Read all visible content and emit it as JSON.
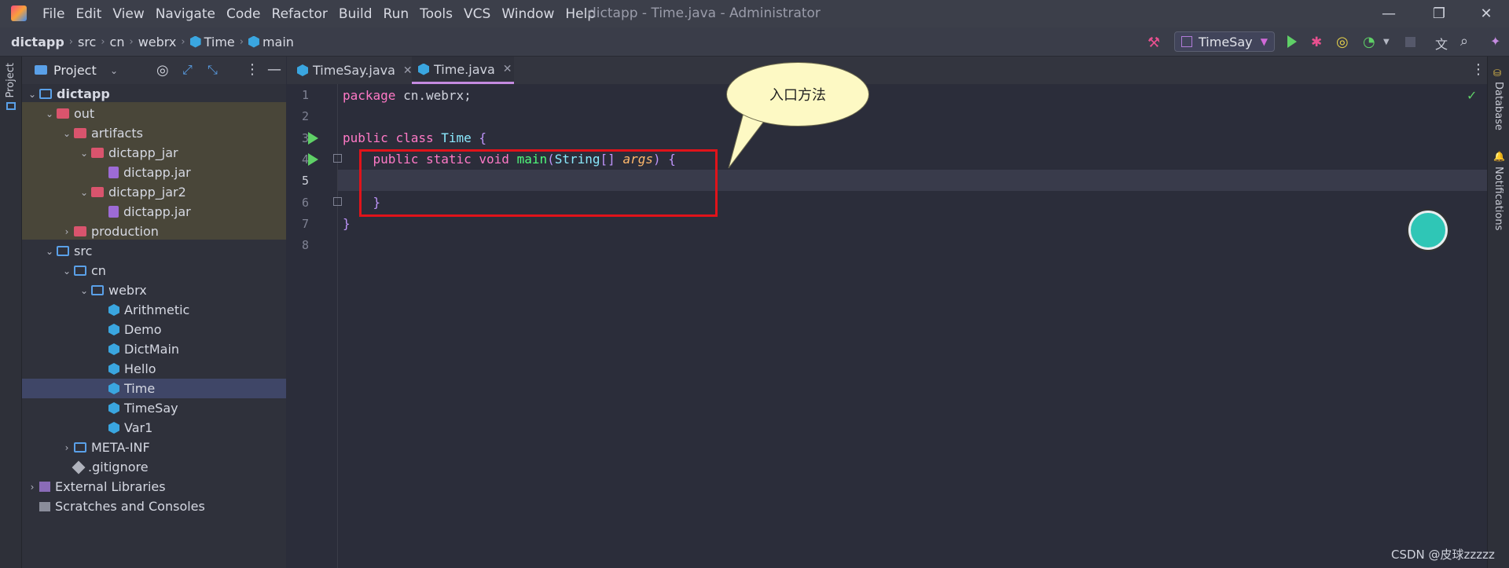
{
  "menu": [
    "File",
    "Edit",
    "View",
    "Navigate",
    "Code",
    "Refactor",
    "Build",
    "Run",
    "Tools",
    "VCS",
    "Window",
    "Help"
  ],
  "window_title": "dictapp - Time.java - Administrator",
  "breadcrumbs": [
    "dictapp",
    "src",
    "cn",
    "webrx",
    "Time",
    "main"
  ],
  "run_config": "TimeSay",
  "side_tabs": {
    "left": "Project",
    "right_top": "Database",
    "right_bottom": "Notifications"
  },
  "project_panel": {
    "title": "Project"
  },
  "tree": [
    {
      "label": "dictapp",
      "bold": true,
      "indent": 0,
      "arrow": "down",
      "icon": "folder-gray"
    },
    {
      "label": "out",
      "indent": 1,
      "arrow": "down",
      "icon": "folder-red"
    },
    {
      "label": "artifacts",
      "indent": 2,
      "arrow": "down",
      "icon": "folder-red"
    },
    {
      "label": "dictapp_jar",
      "indent": 3,
      "arrow": "down",
      "icon": "folder-red"
    },
    {
      "label": "dictapp.jar",
      "indent": 4,
      "arrow": "",
      "icon": "jar"
    },
    {
      "label": "dictapp_jar2",
      "indent": 3,
      "arrow": "down",
      "icon": "folder-red"
    },
    {
      "label": "dictapp.jar",
      "indent": 4,
      "arrow": "",
      "icon": "jar"
    },
    {
      "label": "production",
      "indent": 2,
      "arrow": "right",
      "icon": "folder-red"
    },
    {
      "label": "src",
      "indent": 1,
      "arrow": "down",
      "icon": "folder-blue"
    },
    {
      "label": "cn",
      "indent": 2,
      "arrow": "down",
      "icon": "folder-blue"
    },
    {
      "label": "webrx",
      "indent": 3,
      "arrow": "down",
      "icon": "folder-blue"
    },
    {
      "label": "Arithmetic",
      "indent": 4,
      "arrow": "",
      "icon": "cls"
    },
    {
      "label": "Demo",
      "indent": 4,
      "arrow": "",
      "icon": "cls"
    },
    {
      "label": "DictMain",
      "indent": 4,
      "arrow": "",
      "icon": "cls"
    },
    {
      "label": "Hello",
      "indent": 4,
      "arrow": "",
      "icon": "cls"
    },
    {
      "label": "Time",
      "indent": 4,
      "arrow": "",
      "icon": "cls",
      "selected": true
    },
    {
      "label": "TimeSay",
      "indent": 4,
      "arrow": "",
      "icon": "cls"
    },
    {
      "label": "Var1",
      "indent": 4,
      "arrow": "",
      "icon": "cls"
    },
    {
      "label": "META-INF",
      "indent": 2,
      "arrow": "right",
      "icon": "folder-blue"
    },
    {
      "label": ".gitignore",
      "indent": 2,
      "arrow": "",
      "icon": "git"
    },
    {
      "label": "External Libraries",
      "indent": 0,
      "arrow": "right",
      "icon": "lib"
    },
    {
      "label": "Scratches and Consoles",
      "indent": 0,
      "arrow": "",
      "icon": "scr"
    }
  ],
  "tabs": [
    {
      "label": "TimeSay.java",
      "active": false
    },
    {
      "label": "Time.java",
      "active": true
    }
  ],
  "line_numbers": [
    "1",
    "2",
    "3",
    "4",
    "5",
    "6",
    "7",
    "8"
  ],
  "code": {
    "l1_kw": "package",
    "l1_rest": " cn.webrx;",
    "l3_kw1": "public",
    "l3_kw2": "class",
    "l3_name": "Time",
    "l3_brace": "{",
    "l4_kw1": "public",
    "l4_kw2": "static",
    "l4_kw3": "void",
    "l4_fn": "main",
    "l4_p1": "(",
    "l4_type": "String",
    "l4_arr": "[]",
    "l4_arg": "args",
    "l4_p2": ")",
    "l4_brace": "{",
    "l6_brace": "}",
    "l7_brace": "}"
  },
  "annotation": "入口方法",
  "watermark": "CSDN @皮球zzzzz"
}
